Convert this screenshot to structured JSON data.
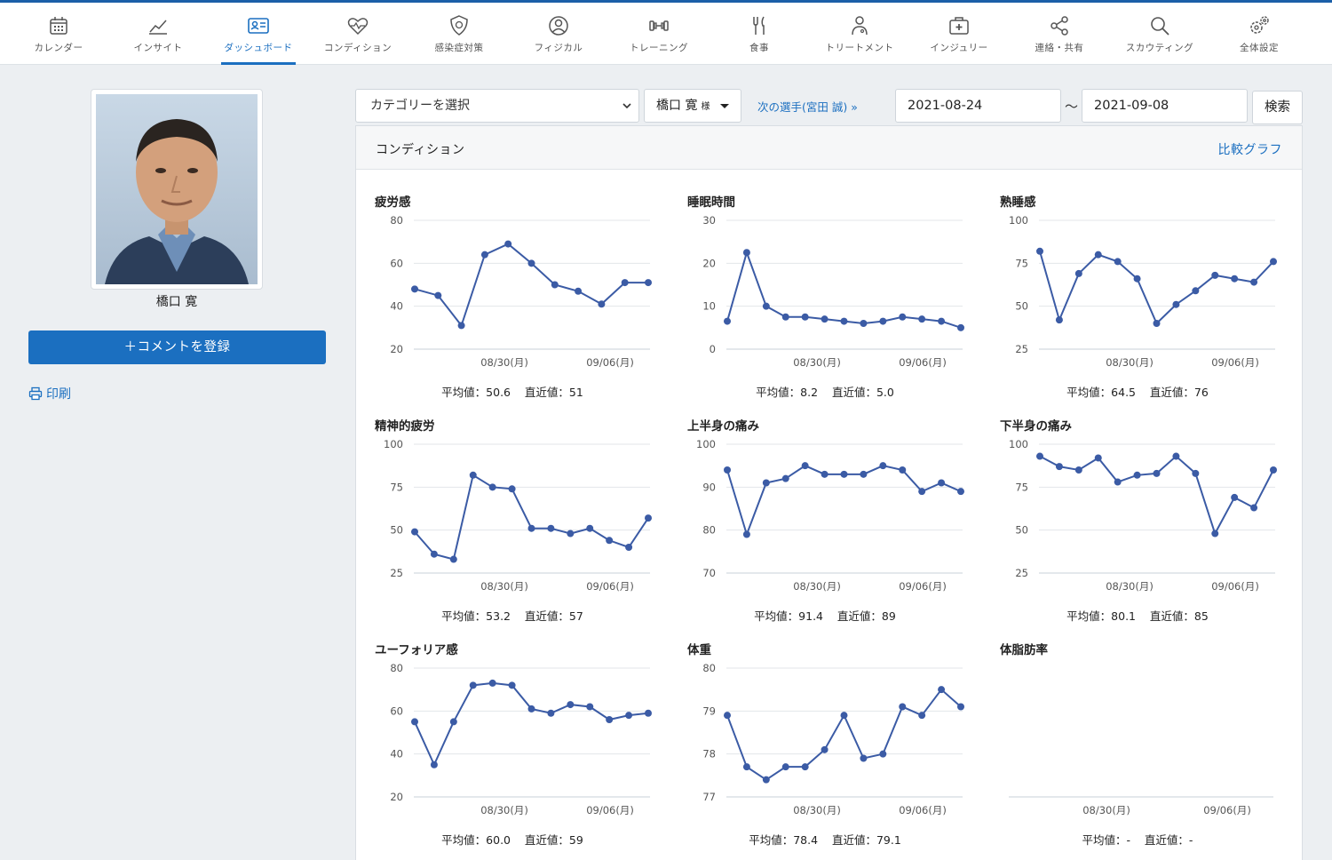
{
  "nav": [
    {
      "label": "カレンダー",
      "icon": "calendar-icon",
      "active": false
    },
    {
      "label": "インサイト",
      "icon": "trend-icon",
      "active": false
    },
    {
      "label": "ダッシュボード",
      "icon": "id-card-icon",
      "active": true
    },
    {
      "label": "コンディション",
      "icon": "heartbeat-icon",
      "active": false
    },
    {
      "label": "感染症対策",
      "icon": "virus-shield-icon",
      "active": false
    },
    {
      "label": "フィジカル",
      "icon": "user-circle-icon",
      "active": false
    },
    {
      "label": "トレーニング",
      "icon": "dumbbell-icon",
      "active": false
    },
    {
      "label": "食事",
      "icon": "fork-knife-icon",
      "active": false
    },
    {
      "label": "トリートメント",
      "icon": "doctor-icon",
      "active": false
    },
    {
      "label": "インジュリー",
      "icon": "medical-kit-icon",
      "active": false
    },
    {
      "label": "連絡・共有",
      "icon": "share-icon",
      "active": false
    },
    {
      "label": "スカウティング",
      "icon": "search-icon",
      "active": false
    },
    {
      "label": "全体設定",
      "icon": "gears-icon",
      "active": false
    }
  ],
  "profile": {
    "name": "橋口 寛",
    "comment_button": "＋コメントを登録",
    "print_label": "印刷"
  },
  "toolbar": {
    "category_select": "カテゴリーを選択",
    "athlete_name": "橋口 寛",
    "athlete_suffix": "様",
    "next_player": "次の選手(宮田 誠) »",
    "date_from": "2021-08-24",
    "separator": "～",
    "date_to": "2021-09-08",
    "search_button": "検索"
  },
  "panel": {
    "title": "コンディション",
    "compare_link": "比較グラフ"
  },
  "colors": {
    "accent": "#1b6fc0",
    "series": "#3b5ba5",
    "nav_border": "#1b5fa8"
  },
  "chart_data": [
    {
      "type": "line",
      "title": "疲労感",
      "ylim": [
        20,
        80
      ],
      "yticks": [
        20,
        40,
        60,
        80
      ],
      "xtick_labels": [
        "08/30(月)",
        "09/06(月)"
      ],
      "x": [
        "08/24",
        "08/25",
        "08/26",
        "08/27",
        "08/28",
        "08/30",
        "08/31",
        "09/02",
        "09/03",
        "09/05",
        "09/06",
        "09/07"
      ],
      "values": [
        48,
        45,
        31,
        64,
        69,
        60,
        50,
        47,
        41,
        51,
        51
      ],
      "stats": {
        "avg_label": "平均値：",
        "avg": "50.6",
        "recent_label": "直近値：",
        "recent": "51"
      }
    },
    {
      "type": "line",
      "title": "睡眠時間",
      "ylim": [
        0,
        30
      ],
      "yticks": [
        0,
        10,
        20,
        30
      ],
      "xtick_labels": [
        "08/30(月)",
        "09/06(月)"
      ],
      "values": [
        6.5,
        22.5,
        10,
        7.5,
        7.5,
        7,
        6.5,
        6,
        6.5,
        7.5,
        7,
        6.5,
        5
      ],
      "stats": {
        "avg_label": "平均値：",
        "avg": "8.2",
        "recent_label": "直近値：",
        "recent": "5.0"
      }
    },
    {
      "type": "line",
      "title": "熟睡感",
      "ylim": [
        25,
        100
      ],
      "yticks": [
        25,
        50,
        75,
        100
      ],
      "xtick_labels": [
        "08/30(月)",
        "09/06(月)"
      ],
      "values": [
        82,
        42,
        69,
        80,
        76,
        66,
        40,
        51,
        59,
        68,
        66,
        64,
        76
      ],
      "stats": {
        "avg_label": "平均値：",
        "avg": "64.5",
        "recent_label": "直近値：",
        "recent": "76"
      }
    },
    {
      "type": "line",
      "title": "精神的疲労",
      "ylim": [
        25,
        100
      ],
      "yticks": [
        25,
        50,
        75,
        100
      ],
      "xtick_labels": [
        "08/30(月)",
        "09/06(月)"
      ],
      "values": [
        49,
        36,
        33,
        82,
        75,
        74,
        51,
        51,
        48,
        51,
        44,
        40,
        57
      ],
      "stats": {
        "avg_label": "平均値：",
        "avg": "53.2",
        "recent_label": "直近値：",
        "recent": "57"
      }
    },
    {
      "type": "line",
      "title": "上半身の痛み",
      "ylim": [
        70,
        100
      ],
      "yticks": [
        70,
        80,
        90,
        100
      ],
      "xtick_labels": [
        "08/30(月)",
        "09/06(月)"
      ],
      "values": [
        94,
        79,
        91,
        92,
        95,
        93,
        93,
        93,
        95,
        94,
        89,
        91,
        89
      ],
      "stats": {
        "avg_label": "平均値：",
        "avg": "91.4",
        "recent_label": "直近値：",
        "recent": "89"
      }
    },
    {
      "type": "line",
      "title": "下半身の痛み",
      "ylim": [
        25,
        100
      ],
      "yticks": [
        25,
        50,
        75,
        100
      ],
      "xtick_labels": [
        "08/30(月)",
        "09/06(月)"
      ],
      "values": [
        93,
        87,
        85,
        92,
        78,
        82,
        83,
        93,
        83,
        48,
        69,
        63,
        85
      ],
      "stats": {
        "avg_label": "平均値：",
        "avg": "80.1",
        "recent_label": "直近値：",
        "recent": "85"
      }
    },
    {
      "type": "line",
      "title": "ユーフォリア感",
      "ylim": [
        20,
        80
      ],
      "yticks": [
        20,
        40,
        60,
        80
      ],
      "xtick_labels": [
        "08/30(月)",
        "09/06(月)"
      ],
      "values": [
        55,
        35,
        55,
        72,
        73,
        72,
        61,
        59,
        63,
        62,
        56,
        58,
        59
      ],
      "stats": {
        "avg_label": "平均値：",
        "avg": "60.0",
        "recent_label": "直近値：",
        "recent": "59"
      }
    },
    {
      "type": "line",
      "title": "体重",
      "ylim": [
        77,
        80
      ],
      "yticks": [
        77,
        78,
        79,
        80
      ],
      "xtick_labels": [
        "08/30(月)",
        "09/06(月)"
      ],
      "values": [
        78.9,
        77.7,
        77.4,
        77.7,
        77.7,
        78.1,
        78.9,
        77.9,
        78.0,
        79.1,
        78.9,
        79.5,
        79.1
      ],
      "stats": {
        "avg_label": "平均値：",
        "avg": "78.4",
        "recent_label": "直近値：",
        "recent": "79.1"
      }
    },
    {
      "type": "line",
      "title": "体脂肪率",
      "ylim": null,
      "yticks": [],
      "xtick_labels": [
        "08/30(月)",
        "09/06(月)"
      ],
      "values": [],
      "stats": {
        "avg_label": "平均値：",
        "avg": "-",
        "recent_label": "直近値：",
        "recent": "-"
      }
    }
  ]
}
